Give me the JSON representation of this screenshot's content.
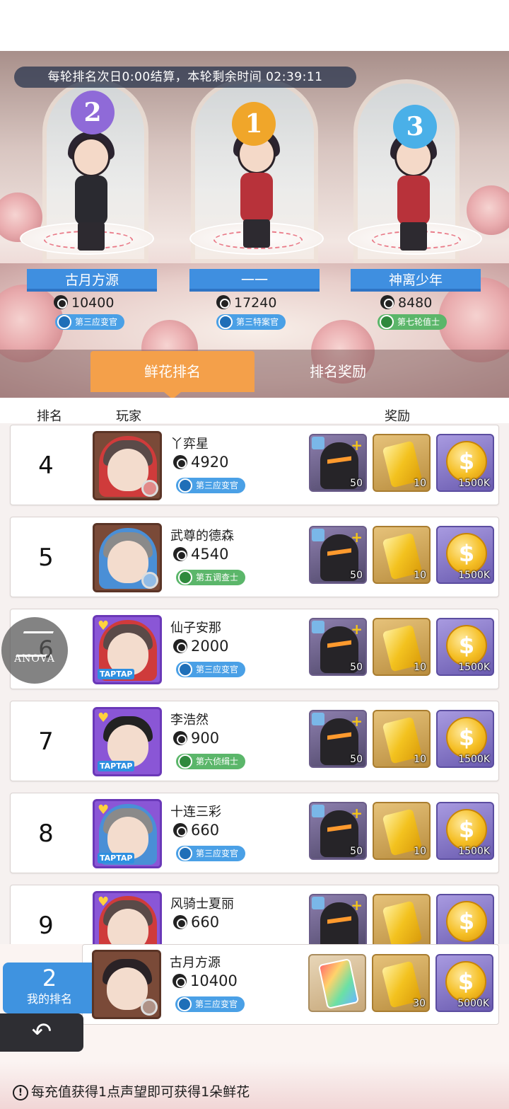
{
  "timer_text": "每轮排名次日0:00结算，本轮剩余时间 02:39:11",
  "podium": [
    {
      "rank": "2",
      "name": "古月方源",
      "score": "10400",
      "title": "第三应变官",
      "title_color": "blue",
      "badge_color": "#8f6ad8"
    },
    {
      "rank": "1",
      "name": "一一",
      "score": "17240",
      "title": "第三特案官",
      "title_color": "blue",
      "badge_color": "#f0a62a"
    },
    {
      "rank": "3",
      "name": "神离少年",
      "score": "8480",
      "title": "第七轮值士",
      "title_color": "green",
      "badge_color": "#4ab0e8"
    }
  ],
  "tabs": {
    "active": "鲜花排名",
    "inactive": "排名奖励"
  },
  "header": {
    "rank": "排名",
    "player": "玩家",
    "reward": "奖励"
  },
  "rows": [
    {
      "rank": "4",
      "name": "丫弈星",
      "score": "4920",
      "title": "第三应变官",
      "title_color": "blue",
      "avatar": "red-hood",
      "rewards": {
        "hero_qty": "50",
        "card_qty": "10",
        "coin_qty": "1500K"
      }
    },
    {
      "rank": "5",
      "name": "武尊的德森",
      "score": "4540",
      "title": "第五调查士",
      "title_color": "green",
      "avatar": "blue-hood",
      "rewards": {
        "hero_qty": "50",
        "card_qty": "10",
        "coin_qty": "1500K"
      }
    },
    {
      "rank": "6",
      "name": "仙子安那",
      "score": "2000",
      "title": "第三应变官",
      "title_color": "blue",
      "avatar": "taptap-red",
      "rewards": {
        "hero_qty": "50",
        "card_qty": "10",
        "coin_qty": "1500K"
      }
    },
    {
      "rank": "7",
      "name": "李浩然",
      "score": "900",
      "title": "第六侦缉士",
      "title_color": "green",
      "avatar": "taptap-plain",
      "rewards": {
        "hero_qty": "50",
        "card_qty": "10",
        "coin_qty": "1500K"
      }
    },
    {
      "rank": "8",
      "name": "十连三彩",
      "score": "660",
      "title": "第三应变官",
      "title_color": "blue",
      "avatar": "taptap-blue",
      "rewards": {
        "hero_qty": "50",
        "card_qty": "10",
        "coin_qty": "1500K"
      }
    },
    {
      "rank": "9",
      "name": "风骑士夏丽",
      "score": "660",
      "title": "",
      "title_color": "blue",
      "avatar": "red-hood-purple",
      "rewards": {
        "hero_qty": "",
        "card_qty": "",
        "coin_qty": ""
      }
    }
  ],
  "taptap_label": "TAPTAP",
  "my_rank": {
    "rank": "2",
    "label": "我的排名",
    "name": "古月方源",
    "score": "10400",
    "title": "第三应变官",
    "rewards": {
      "ticket_qty": "",
      "card_qty": "30",
      "coin_qty": "5000K"
    }
  },
  "overlay_logo": "ANOVA",
  "notice": "每充值获得1点声望即可获得1朵鲜花",
  "icons": {
    "back": "back-arrow-icon",
    "rose": "rose-icon",
    "info": "info-icon"
  }
}
